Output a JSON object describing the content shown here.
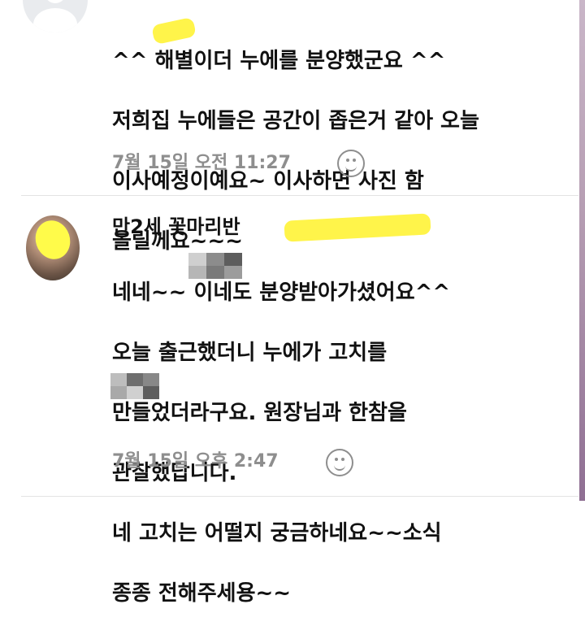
{
  "comments": [
    {
      "author": "",
      "lines": [
        "^^ 해별이더 누에를 분양했군요 ^^",
        "저희집 누에들은 공간이 좁은거 같아 오늘",
        "이사예정이예요~ 이사하면 사진 함",
        "올릴께요~~~"
      ],
      "time": "7월 15일 오전 11:27",
      "reaction_icon": "smiley-icon"
    },
    {
      "author": "만2세 꽃마리반 ",
      "lines": [
        "네네~~      이네도 분양받아가셨어요^^",
        "오늘 출근했더니 누에가 고치를",
        "만들었더라구요. 원장님과 한참을",
        "관찰했답니다.",
        "      네 고치는 어떨지 궁금하네요~~소식",
        "종종 전해주세용~~"
      ],
      "time": "7월 15일 오후 2:47",
      "reaction_icon": "smiley-icon"
    }
  ]
}
